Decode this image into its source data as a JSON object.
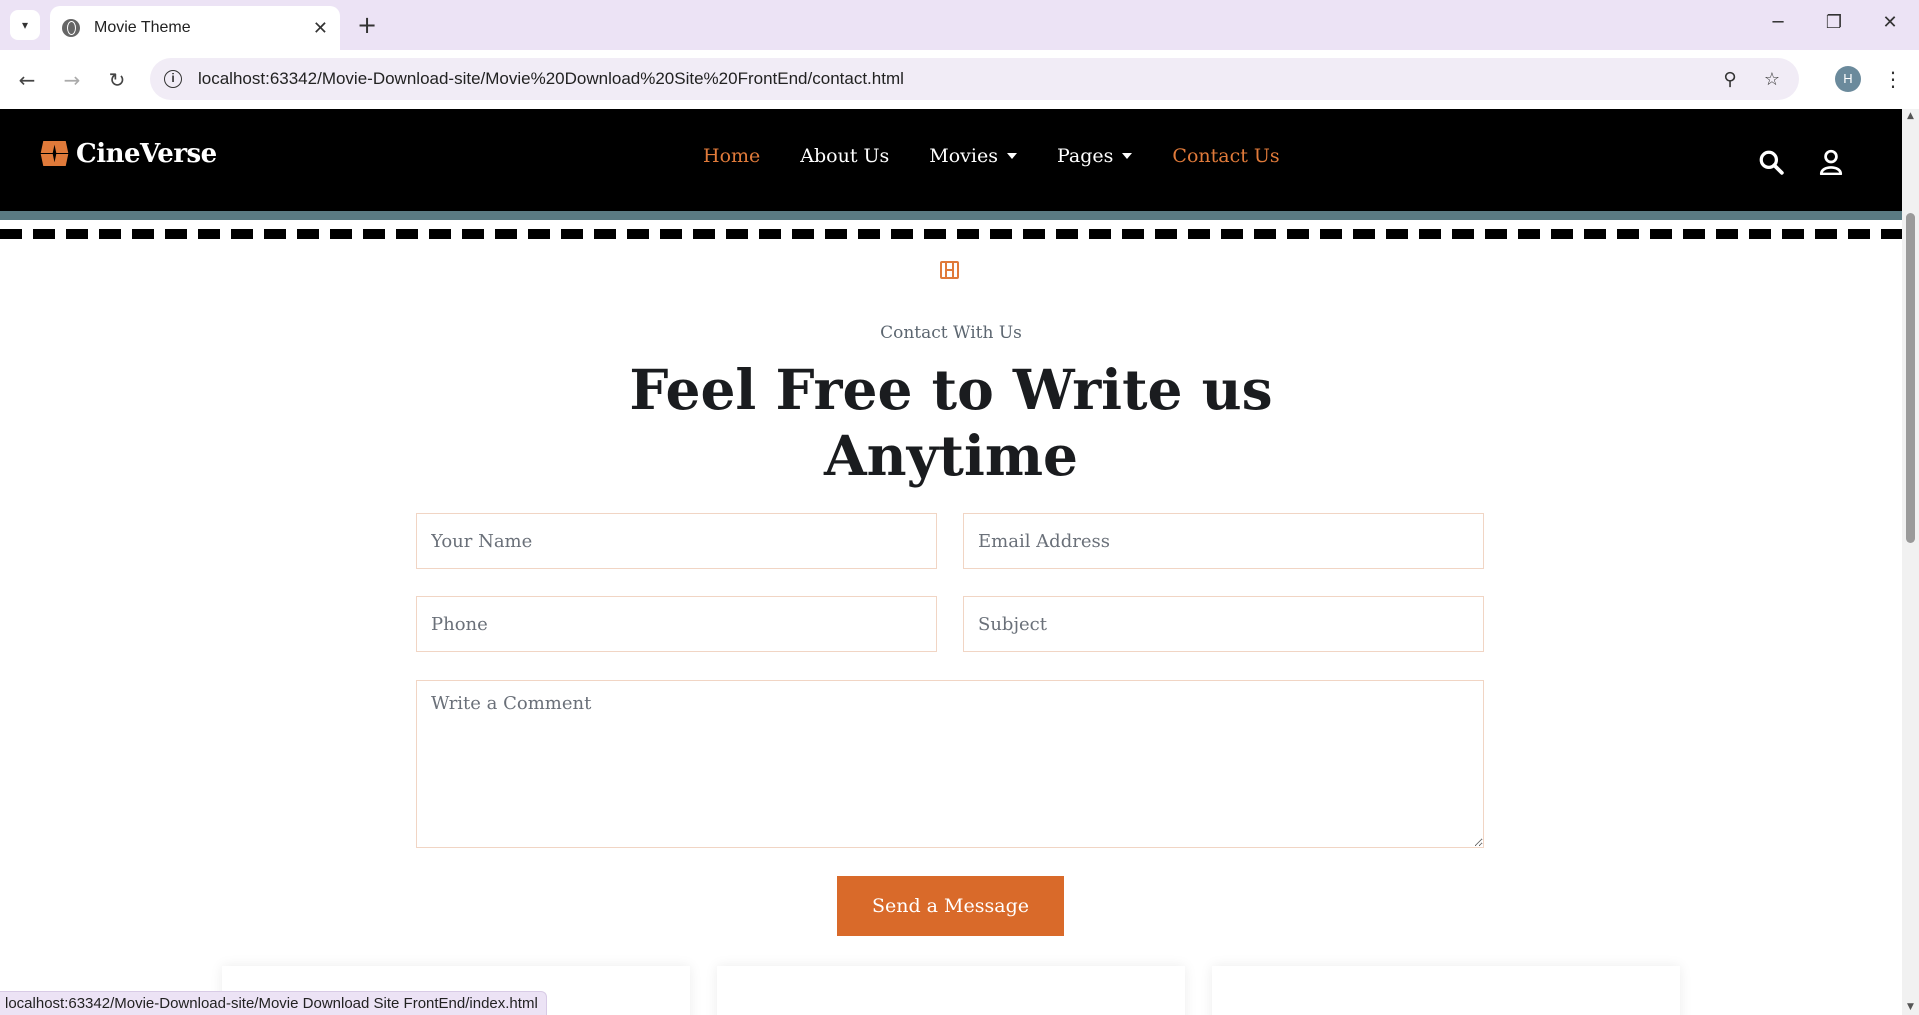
{
  "browser": {
    "tab_title": "Movie Theme",
    "url": "localhost:63342/Movie-Download-site/Movie%20Download%20Site%20FrontEnd/contact.html",
    "profile_initial": "H",
    "status_url": "localhost:63342/Movie-Download-site/Movie Download Site FrontEnd/index.html"
  },
  "site": {
    "logo_text": "CineVerse",
    "nav": [
      {
        "label": "Home",
        "active": true
      },
      {
        "label": "About Us",
        "active": false
      },
      {
        "label": "Movies",
        "active": false
      },
      {
        "label": "Pages",
        "active": false
      },
      {
        "label": "Contact Us",
        "active": true
      }
    ],
    "accent_color": "#e07a3a"
  },
  "contact": {
    "kicker": "Contact With Us",
    "headline_line1": "Feel Free to Write us",
    "headline_line2": "Anytime",
    "form": {
      "name_placeholder": "Your Name",
      "email_placeholder": "Email Address",
      "phone_placeholder": "Phone",
      "subject_placeholder": "Subject",
      "comment_placeholder": "Write a Comment",
      "submit_label": "Send a Message"
    }
  }
}
